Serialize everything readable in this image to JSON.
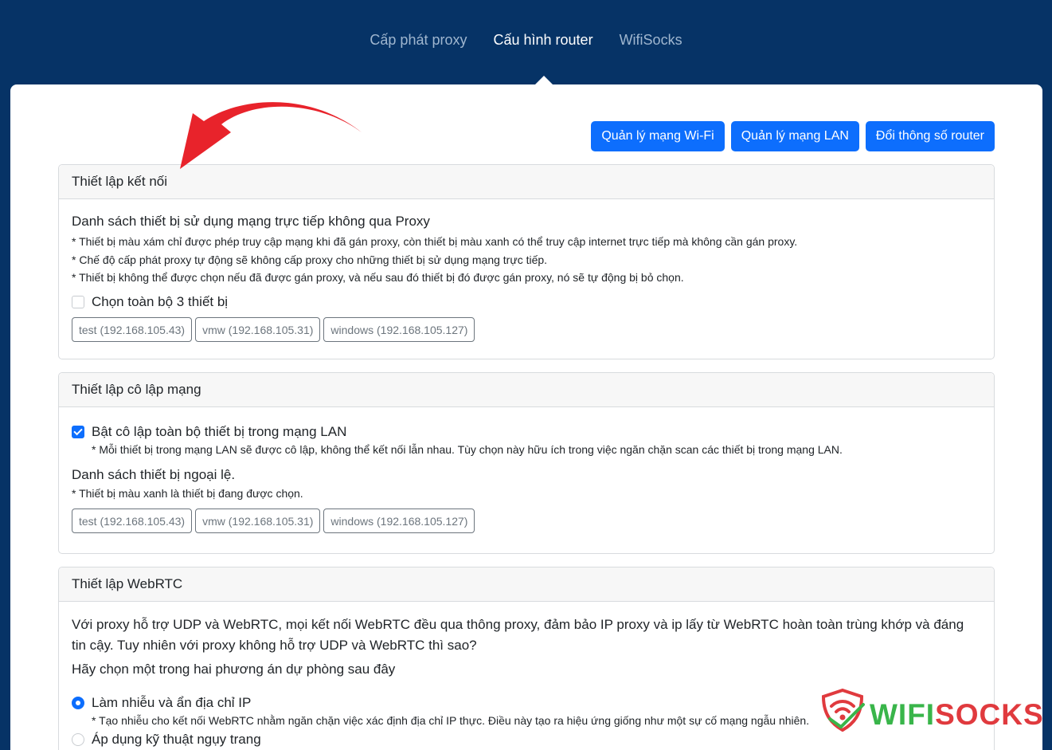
{
  "nav": {
    "tabs": [
      {
        "label": "Cấp phát proxy",
        "active": false
      },
      {
        "label": "Cấu hình router",
        "active": true
      },
      {
        "label": "WifiSocks",
        "active": false
      }
    ]
  },
  "toolbar": {
    "wifi_button": "Quản lý mạng Wi-Fi",
    "lan_button": "Quản lý mạng LAN",
    "router_button": "Đổi thông số router"
  },
  "connection": {
    "title": "Thiết lập kết nối",
    "heading": "Danh sách thiết bị sử dụng mạng trực tiếp không qua Proxy",
    "notes": [
      "* Thiết bị màu xám chỉ được phép truy cập mạng khi đã gán proxy, còn thiết bị màu xanh có thể truy cập internet trực tiếp mà không cần gán proxy.",
      "* Chế độ cấp phát proxy tự động sẽ không cấp proxy cho những thiết bị sử dụng mạng trực tiếp.",
      "* Thiết bị không thể được chọn nếu đã được gán proxy, và nếu sau đó thiết bị đó được gán proxy, nó sẽ tự động bị bỏ chọn."
    ],
    "select_all_label": "Chọn toàn bộ 3 thiết bị",
    "select_all_checked": false,
    "devices": [
      "test (192.168.105.43)",
      "vmw (192.168.105.31)",
      "windows (192.168.105.127)"
    ]
  },
  "isolation": {
    "title": "Thiết lập cô lập mạng",
    "toggle_label": "Bật cô lập toàn bộ thiết bị trong mạng LAN",
    "toggle_checked": true,
    "toggle_note": "* Mỗi thiết bị trong mạng LAN sẽ được cô lập, không thể kết nối lẫn nhau. Tùy chọn này hữu ích trong việc ngăn chặn scan các thiết bị trong mạng LAN.",
    "exceptions_heading": "Danh sách thiết bị ngoại lệ.",
    "exceptions_note": "* Thiết bị màu xanh là thiết bị đang được chọn.",
    "devices": [
      "test (192.168.105.43)",
      "vmw (192.168.105.31)",
      "windows (192.168.105.127)"
    ]
  },
  "webrtc": {
    "title": "Thiết lập WebRTC",
    "intro_line1": "Với proxy hỗ trợ UDP và WebRTC, mọi kết nối WebRTC đều qua thông proxy, đảm bảo IP proxy và ip lấy từ WebRTC hoàn toàn trùng khớp và đáng",
    "intro_line2": "tin cậy. Tuy nhiên với proxy không hỗ trợ UDP và WebRTC thì sao?",
    "choose_text": "Hãy chọn một trong hai phương án dự phòng sau đây",
    "options": [
      {
        "label": "Làm nhiễu và ẩn địa chỉ IP",
        "selected": true,
        "note": "* Tạo nhiễu cho kết nối WebRTC nhằm ngăn chặn việc xác định địa chỉ IP thực. Điều này tạo ra hiệu ứng giống như một sự cố mạng ngẫu nhiên."
      },
      {
        "label": "Áp dụng kỹ thuật ngụy trang",
        "selected": false
      }
    ]
  },
  "watermark": {
    "part1": "WIFI",
    "part2": "SOCKS"
  },
  "colors": {
    "nav_bg": "#063366",
    "primary": "#0d6efd",
    "arrow": "#e8232b",
    "logo_green": "#39b54a",
    "logo_red": "#e03a3e"
  }
}
